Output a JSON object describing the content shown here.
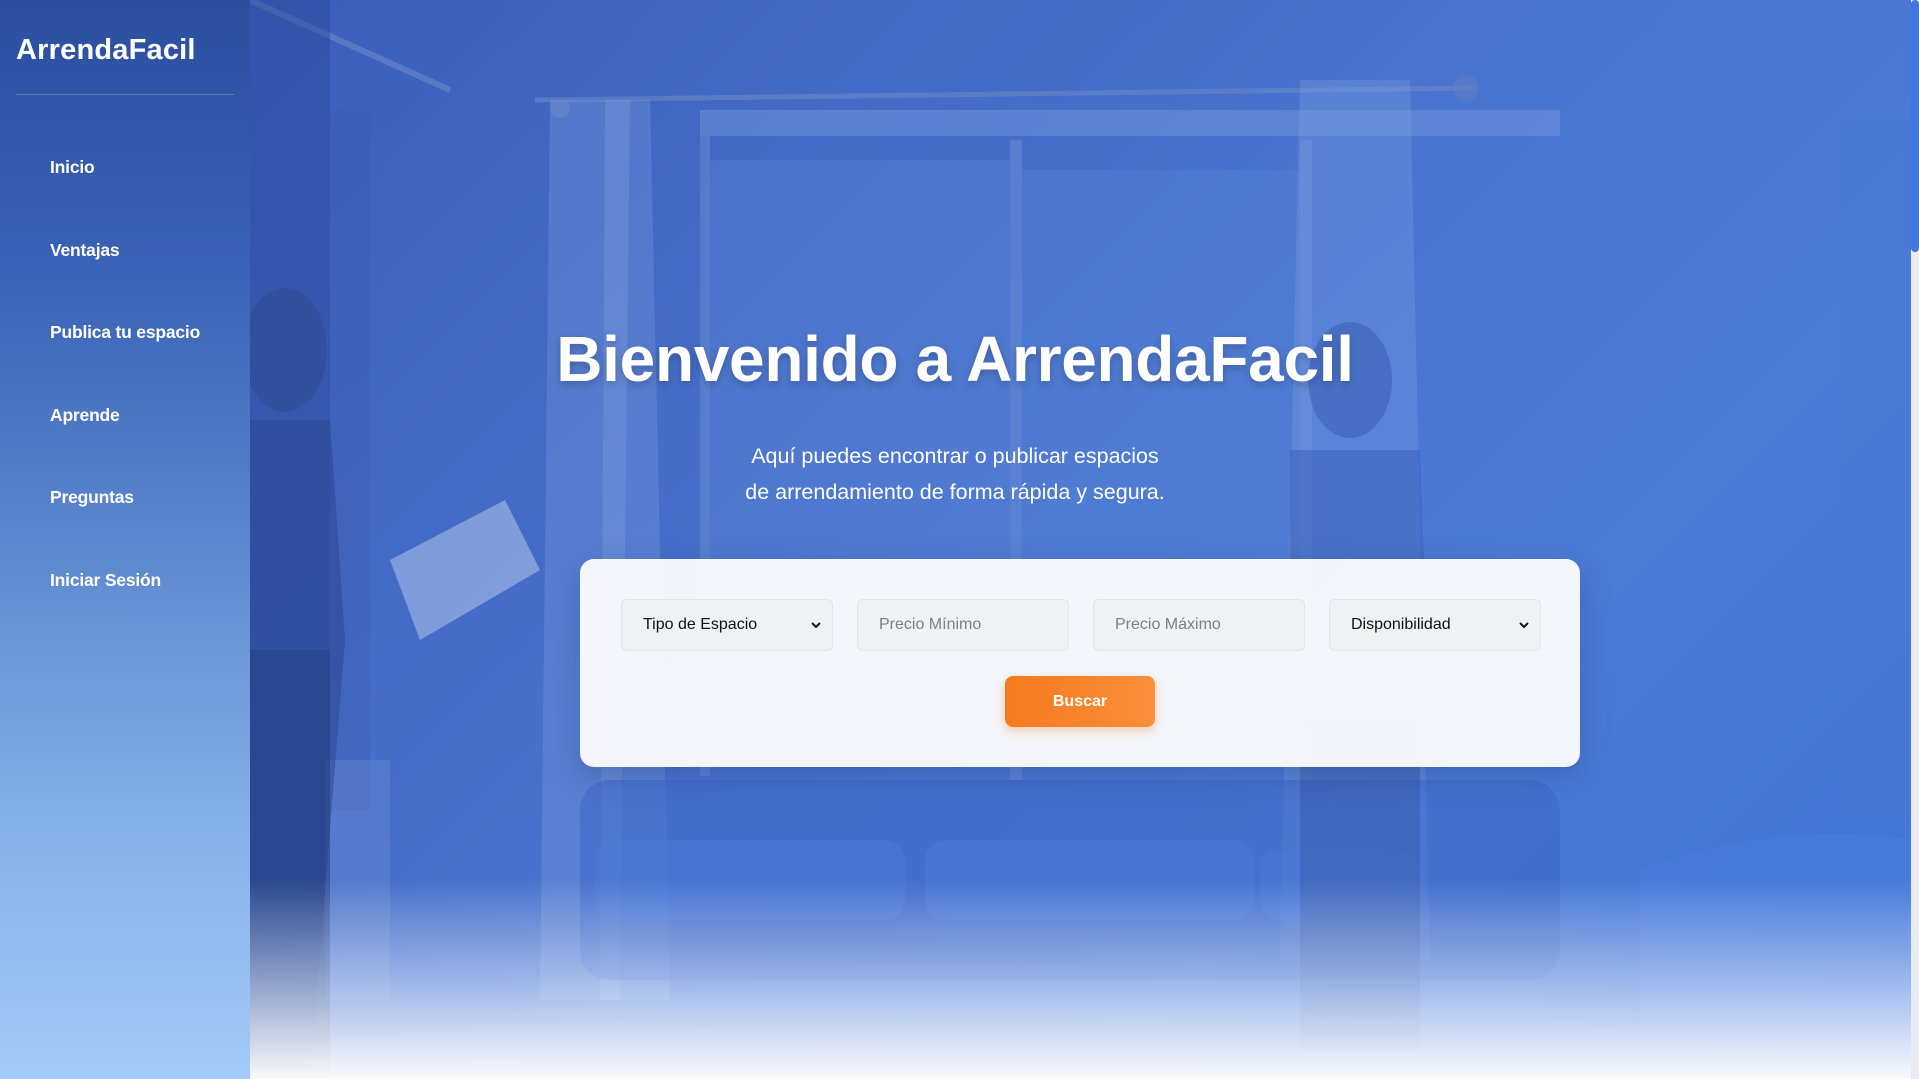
{
  "brand": {
    "name": "ArrendaFacil"
  },
  "nav": {
    "items": [
      {
        "label": "Inicio"
      },
      {
        "label": "Ventajas"
      },
      {
        "label": "Publica tu espacio"
      },
      {
        "label": "Aprende"
      },
      {
        "label": "Preguntas"
      },
      {
        "label": "Iniciar Sesión"
      }
    ]
  },
  "hero": {
    "title": "Bienvenido a ArrendaFacil",
    "subtitle": "Aquí puedes encontrar o publicar espacios de arrendamiento de forma rápida y segura."
  },
  "search": {
    "space_type": {
      "selected": "Tipo de Espacio"
    },
    "min_price": {
      "placeholder": "Precio Mínimo",
      "value": ""
    },
    "max_price": {
      "placeholder": "Precio Máximo",
      "value": ""
    },
    "availability": {
      "selected": "Disponibilidad"
    },
    "button_label": "Buscar"
  },
  "colors": {
    "accent": "#f57a1f",
    "hero_overlay": "#3f68c4",
    "sidebar_top": "#2c4f9f",
    "sidebar_bottom": "#a3cbf8"
  },
  "icons": {
    "select_arrow": "chevron-down-icon"
  }
}
